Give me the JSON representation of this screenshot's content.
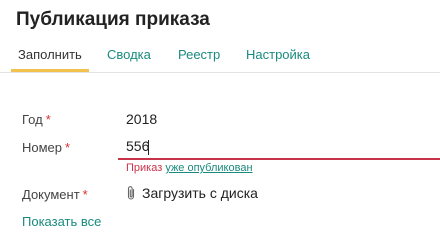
{
  "header": {
    "title": "Публикация приказа"
  },
  "tabs": [
    {
      "label": "Заполнить"
    },
    {
      "label": "Сводка"
    },
    {
      "label": "Реестр"
    },
    {
      "label": "Настройка"
    }
  ],
  "form": {
    "required_mark": "*",
    "year": {
      "label": "Год",
      "value": "2018"
    },
    "number": {
      "label": "Номер",
      "value": "556",
      "error_prefix": "Приказ",
      "error_link": "уже опубликован"
    },
    "document": {
      "label": "Документ",
      "upload_label": "Загрузить с диска"
    }
  },
  "footer": {
    "show_all": "Показать все"
  },
  "icons": {
    "upload": "paperclip-icon"
  },
  "colors": {
    "accent": "#1a8a7e",
    "error": "#c8334a",
    "tab_underline": "#f2c14e"
  }
}
